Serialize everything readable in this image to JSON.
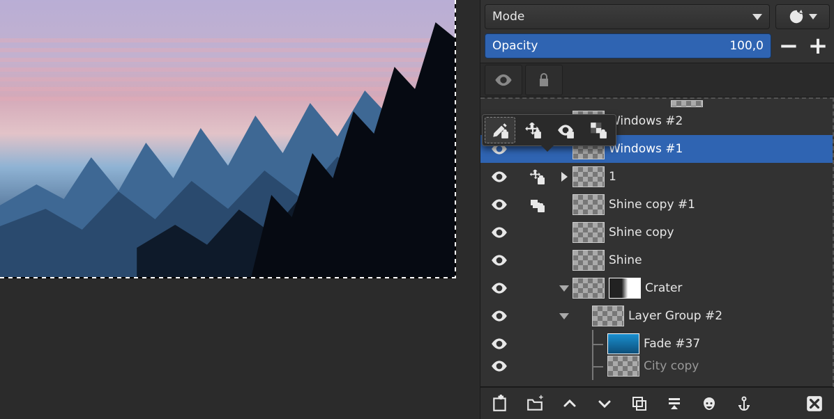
{
  "mode": {
    "label": "Mode"
  },
  "opacity": {
    "label": "Opacity",
    "value": "100,0"
  },
  "lock_popup_icons": [
    "brush-lock",
    "move-lock",
    "visibility-lock",
    "alpha-lock"
  ],
  "layers": [
    {
      "name": "Windows #2",
      "indent": 0,
      "selected": false,
      "visible": true,
      "thumbs": 1
    },
    {
      "name": "Windows #1",
      "indent": 0,
      "selected": true,
      "visible": true,
      "thumbs": 1
    },
    {
      "name": "1",
      "indent": 0,
      "selected": false,
      "visible": true,
      "link": true,
      "expand": "right",
      "thumbs": 1
    },
    {
      "name": "Shine copy #1",
      "indent": 0,
      "selected": false,
      "visible": true,
      "lock": true,
      "thumbs": 1
    },
    {
      "name": "Shine copy",
      "indent": 0,
      "selected": false,
      "visible": true,
      "thumbs": 1
    },
    {
      "name": "Shine",
      "indent": 0,
      "selected": false,
      "visible": true,
      "thumbs": 1
    },
    {
      "name": "Crater",
      "indent": 0,
      "selected": false,
      "visible": true,
      "expand": "down",
      "thumbs": 2,
      "thumb2class": "white"
    },
    {
      "name": "Layer Group #2",
      "indent": 1,
      "selected": false,
      "visible": true,
      "expand": "down",
      "thumbs": 1
    },
    {
      "name": "Fade #37",
      "indent": 2,
      "selected": false,
      "visible": true,
      "thumbs": 1,
      "thumbclass": "blue",
      "tree": "mid"
    },
    {
      "name": "City copy",
      "indent": 2,
      "selected": false,
      "visible": true,
      "thumbs": 1,
      "tree": "mid",
      "cut": true
    }
  ],
  "bottom_icons": [
    "new-layer",
    "new-group",
    "move-up",
    "move-down",
    "duplicate",
    "merge-down",
    "mask",
    "anchor",
    "delete"
  ]
}
